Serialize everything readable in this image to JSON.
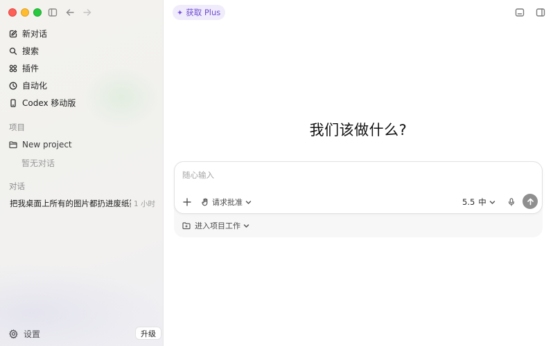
{
  "sidebar": {
    "nav": [
      {
        "label": "新对话",
        "icon": "compose-icon"
      },
      {
        "label": "搜索",
        "icon": "search-icon"
      },
      {
        "label": "插件",
        "icon": "grid-icon"
      },
      {
        "label": "自动化",
        "icon": "clock-icon"
      },
      {
        "label": "Codex 移动版",
        "icon": "phone-icon"
      }
    ],
    "projects_label": "项目",
    "project_name": "New project",
    "project_empty": "暂无对话",
    "conversations_label": "对话",
    "conversation": {
      "title": "把我桌面上所有的图片都扔进废纸篓",
      "time": "1 小时"
    },
    "settings_label": "设置",
    "upgrade_label": "升级"
  },
  "main": {
    "plus_label": "获取 Plus",
    "hero": "我们该做什么?",
    "composer": {
      "placeholder": "随心输入",
      "approval_label": "请求批准",
      "model_version": "5.5",
      "model_effort": "中",
      "enter_project_label": "进入项目工作"
    }
  },
  "colors": {
    "accent": "#6e4dd3",
    "plus_bg": "#f1ecfb",
    "send_button": "#8f8f8f"
  }
}
